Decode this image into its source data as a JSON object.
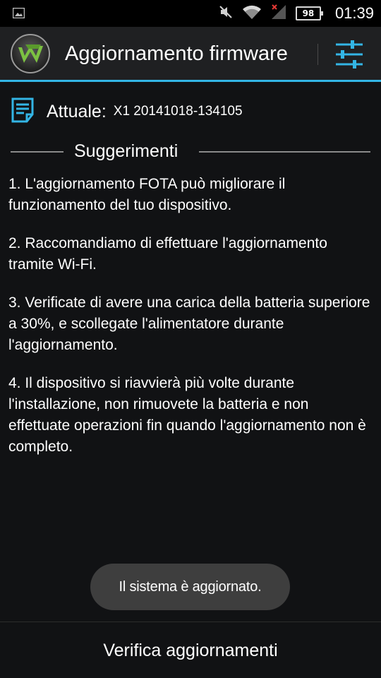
{
  "status_bar": {
    "notification_icon": "image-icon",
    "muted_icon": "muted-speaker-icon",
    "wifi_icon": "wifi-icon",
    "signal_icon": "signal-icon",
    "battery_level": "98",
    "time": "01:39"
  },
  "action_bar": {
    "title": "Aggiornamento firmware",
    "logo_icon": "app-logo-icon",
    "settings_icon": "settings-sliders-icon",
    "accent_color": "#33b5e5"
  },
  "current": {
    "label": "Attuale:",
    "value": "X1 20141018-134105",
    "icon": "document-icon"
  },
  "suggestions": {
    "title": "Suggerimenti",
    "items": [
      "1. L'aggiornamento FOTA può migliorare il funzionamento del tuo dispositivo.",
      "2. Raccomandiamo di effettuare l'aggiornamento tramite Wi-Fi.",
      "3. Verificate di avere una carica della batteria superiore a 30%, e scollegate l'alimentatore durante l'aggiornamento.",
      "4. Il dispositivo si riavvierà più volte durante l'installazione, non rimuovete la batteria e non effettuate operazioni fin quando l'aggiornamento non è completo."
    ]
  },
  "toast": {
    "message": "Il sistema è aggiornato."
  },
  "bottom": {
    "button_label": "Verifica aggiornamenti"
  }
}
